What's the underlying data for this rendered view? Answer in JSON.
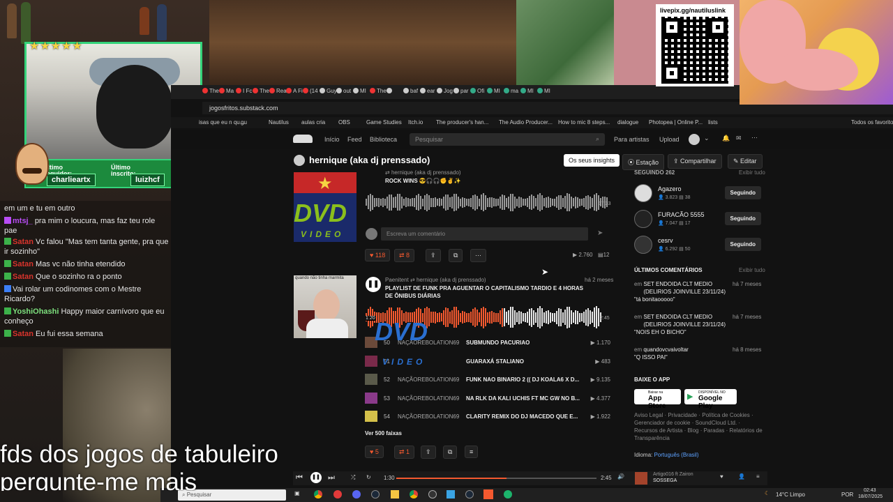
{
  "stream": {
    "stars": "★★★★★",
    "last_follower_label": "Último seguidor:",
    "last_follower_name": "charlieartx",
    "last_sub_label": "Último inscrito:",
    "last_sub_name": "luizhcf",
    "subtitle_line1": "fds dos jogos de tabuleiro",
    "subtitle_line2": "pergunte-me mais",
    "qr_link": "livepix.gg/nautiluslink"
  },
  "chat": [
    {
      "user": "",
      "user_color": "#e6e6e6",
      "text": "em um e tu em outro"
    },
    {
      "user": "mtsj_",
      "user_color": "#b84df5",
      "text": "pra mim o loucura, mas faz teu role pae"
    },
    {
      "user": "Satan",
      "user_color": "#d9342c",
      "text": "Vc falou \"Mas tem tanta gente, pra que ir sozinho\""
    },
    {
      "user": "Satan",
      "user_color": "#d9342c",
      "text": "Mas vc não tinha etendido"
    },
    {
      "user": "Satan",
      "user_color": "#d9342c",
      "text": "Que o sozinho ra o ponto"
    },
    {
      "user": "",
      "user_color": "#3d7ff5",
      "text": "Vai rolar um codinomes com o Mestre Ricardo?"
    },
    {
      "user": "YoshiOhashi",
      "user_color": "#7de07d",
      "text": "Happy maior carnívoro que eu conheço"
    },
    {
      "user": "Satan",
      "user_color": "#d9342c",
      "text": "Eu fui essa semana"
    }
  ],
  "browser": {
    "tabs": [
      "The",
      "Ma",
      "I Fc",
      "The",
      "Rea",
      "A Fi",
      "(14",
      "Guy",
      "out",
      "MI",
      "The",
      "",
      "baf",
      "ear",
      "Jog",
      "par",
      "Ofi",
      "MI",
      "ma",
      "MI",
      "MI"
    ],
    "url": "jogosfritos.substack.com",
    "bookmarks": [
      "isas que eu n qu...",
      "gu",
      "Nautilus",
      "aulas cria",
      "OBS",
      "Game Studies",
      "Itch.io",
      "The producer's han...",
      "The Audio Producer...",
      "How to mic 8 steps...",
      "dialogue",
      "Photopea | Online P...",
      "lists",
      "Todos os favoritos"
    ]
  },
  "soundcloud": {
    "nav": {
      "home": "Início",
      "feed": "Feed",
      "library": "Biblioteca",
      "search_placeholder": "Pesquisar",
      "for_artists": "Para artistas",
      "upload": "Upload"
    },
    "profile_name": "hernique (aka dj prenssado)",
    "actions": {
      "insights": "Os seus insights",
      "station": "Estação",
      "share": "Compartilhar",
      "edit": "Editar"
    },
    "track1": {
      "reposter": "hernique (aka dj prenssado)",
      "title": "ROCK WINS 😎🎧🎧✊✌✨",
      "duration": "17:33",
      "comment_placeholder": "Escreva um comentário",
      "likes": "118",
      "reposts": "8",
      "plays": "2.760",
      "comments": "12",
      "art_text": "DVD",
      "art_sub": "VIDEO"
    },
    "track2": {
      "uploader": "Paenitent",
      "reposter": "hernique (aka dj prenssado)",
      "time_ago": "há 2 meses",
      "title": "PLAYLIST DE FUNK PRA AGUENTAR O CAPITALISMO TARDIO E 4 HORAS DE ÔNIBUS DIÁRIAS",
      "art_caption": "quando não tinha marmita",
      "position": "1:20",
      "duration": "2:45",
      "more": "Ver 500 faixas",
      "likes": "5",
      "reposts": "1"
    },
    "playlist": [
      {
        "num": "50",
        "artist": "NAÇÃOREBOLATION69",
        "title": "SUBMUNDO PACURIAO",
        "plays": "1.170"
      },
      {
        "num": "51",
        "artist": "",
        "title": "GUARAXÁ STALIANO",
        "plays": "483"
      },
      {
        "num": "52",
        "artist": "NAÇÃOREBOLATION69",
        "title": "FUNK NAO BINARIO 2 (( DJ KOALA6 X D...",
        "plays": "9.135"
      },
      {
        "num": "53",
        "artist": "NAÇÃOREBOLATION69",
        "title": "NA RLK DA KALI UCHIS FT MC GW NO B...",
        "plays": "4.377"
      },
      {
        "num": "54",
        "artist": "NAÇÃOREBOLATION69",
        "title": "CLARITY REMIX DO DJ MACEDO QUE E...",
        "plays": "1.922"
      }
    ],
    "right": {
      "following_header": "SEGUINDO 262",
      "following_all": "Exibir tudo",
      "following": [
        {
          "name": "Agazero",
          "followers": "3.823",
          "tracks": "38",
          "button": "Seguindo"
        },
        {
          "name": "FURACÃO 5555",
          "followers": "7.047",
          "tracks": "17",
          "button": "Seguindo"
        },
        {
          "name": "cesrv",
          "followers": "6.292",
          "tracks": "50",
          "button": "Seguindo"
        }
      ],
      "comments_header": "ÚLTIMOS COMENTÁRIOS",
      "comments_all": "Exibir tudo",
      "comments": [
        {
          "prefix": "em",
          "track": "SET ENDOIDA CLT MEDIO (DELIRIOS JOINVILLE 23/11/24)",
          "ago": "há 7 meses",
          "text": "\"tá bonitaooooo\""
        },
        {
          "prefix": "em",
          "track": "SET ENDOIDA CLT MEDIO (DELIRIOS JOINVILLE 23/11/24)",
          "ago": "há 7 meses",
          "text": "\"NOIS EH O BICHO\""
        },
        {
          "prefix": "em",
          "track": "quandovcvaivoltar",
          "ago": "há 8 meses",
          "text": "\"Q ISSO PAI\""
        }
      ],
      "app_header": "BAIXE O APP",
      "app_store": "App Store",
      "app_store_sub": "Baixar na",
      "google_play": "Google Play",
      "google_play_sub": "DISPONÍVEL NO",
      "footer": "Aviso Legal · Privacidade · Política de Cookies · Gerenciador de cookie · SoundCloud Ltd. · Recursos de Artista · Blog · Paradas · Relatórios de Transparência",
      "language_label": "Idioma:",
      "language_value": "Português (Brasil)"
    },
    "player": {
      "elapsed": "1:30",
      "total": "2:45",
      "artist": "Artigo016 ft Zairon",
      "track": "SOSSEGA",
      "progress": 0.55
    }
  },
  "taskbar": {
    "search": "Pesquisar",
    "weather": "14°C  Limpo",
    "lang": "POR",
    "time": "02:43",
    "date": "18/07/2025"
  }
}
